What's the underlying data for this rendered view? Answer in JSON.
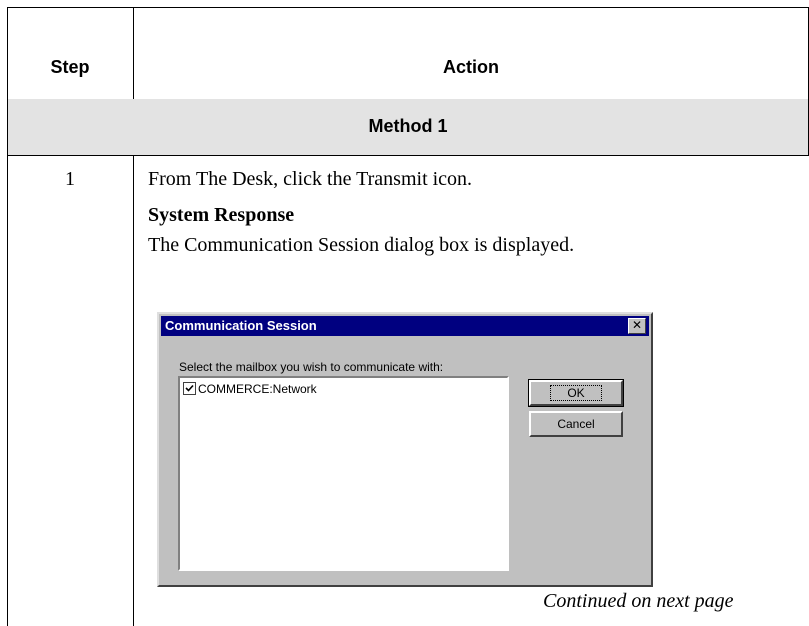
{
  "table": {
    "headers": {
      "step": "Step",
      "action": "Action"
    },
    "method_label": "Method 1",
    "rows": [
      {
        "step": "1",
        "instruction": "From The Desk, click the Transmit icon.",
        "response_title": "System Response",
        "response_text": "The Communication Session dialog box is displayed."
      }
    ],
    "continued": "Continued on next page"
  },
  "dialog": {
    "title": "Communication Session",
    "prompt": "Select the mailbox you wish to communicate with:",
    "list_items": [
      {
        "label": "COMMERCE:Network",
        "checked": true
      }
    ],
    "ok_label": "OK",
    "cancel_label": "Cancel",
    "close_glyph": "✕",
    "title_bar_color": "#000080",
    "face_color": "#c0c0c0"
  }
}
